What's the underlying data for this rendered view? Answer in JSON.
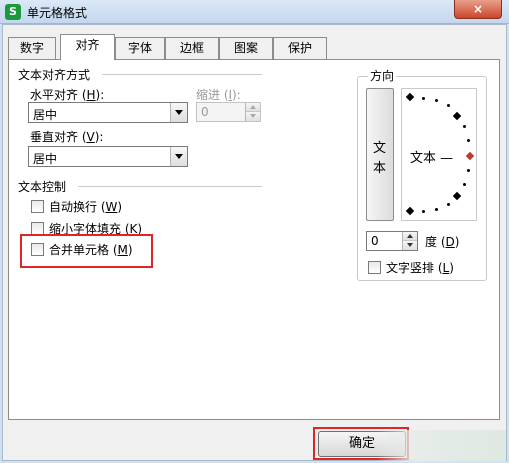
{
  "window": {
    "title": "单元格格式",
    "app_icon": "S",
    "close_glyph": "×"
  },
  "tabs": [
    "数字",
    "对齐",
    "字体",
    "边框",
    "图案",
    "保护"
  ],
  "active_tab": "对齐",
  "alignment": {
    "section_label": "文本对齐方式",
    "horizontal_label": "水平对齐 (",
    "horizontal_key": "H",
    "horizontal_value": "居中",
    "indent_label": "缩进 (",
    "indent_key": "I",
    "indent_value": "0",
    "vertical_label": "垂直对齐 (",
    "vertical_key": "V",
    "vertical_value": "居中"
  },
  "text_control": {
    "section_label": "文本控制",
    "wrap_label": "自动换行 (",
    "wrap_key": "W",
    "shrink_label": "缩小字体填充 (",
    "shrink_key": "K",
    "merge_label": "合并单元格 (",
    "merge_key": "M"
  },
  "orientation": {
    "section_label": "方向",
    "vertical_text_char1": "文",
    "vertical_text_char2": "本",
    "dial_text": "文本 —",
    "degree_value": "0",
    "degree_label": "度 (",
    "degree_key": "D",
    "vertical_layout_label": "文字竖排 (",
    "vertical_layout_key": "L",
    "pointer_color": "#c0392b"
  },
  "buttons": {
    "ok_label": "确定"
  },
  "highlight_color": "#e02525"
}
